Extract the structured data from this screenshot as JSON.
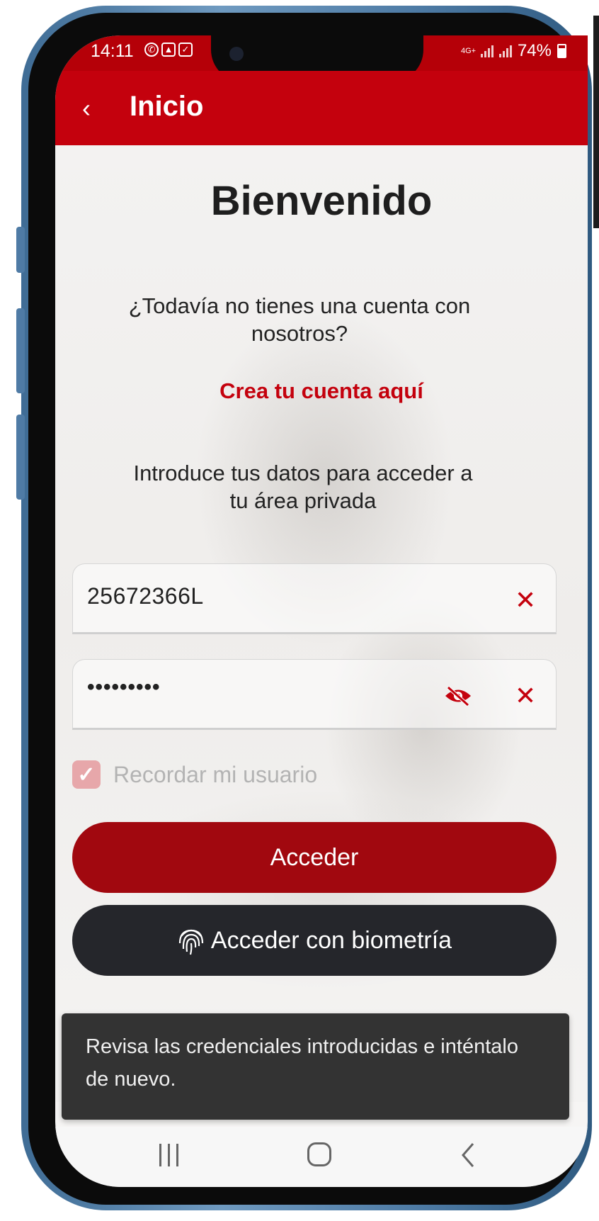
{
  "status_bar": {
    "time": "14:11",
    "icons": [
      "whatsapp-icon",
      "gallery-icon",
      "checkbox-icon"
    ],
    "network": "4G+",
    "battery": "74%",
    "battery_level": 0.74
  },
  "app_bar": {
    "title": "Inicio",
    "back_icon": "chevron-left-icon"
  },
  "welcome": "Bienvenido",
  "no_account_text": "¿Todavía no tienes una cuenta con nosotros?",
  "create_account_link": "Crea tu cuenta aquí",
  "intro_text": "Introduce tus datos para acceder a tu área privada",
  "form": {
    "username_value": "25672366L",
    "password_value": "•••••••••",
    "remember_label": "Recordar mi usuario",
    "remember_checked": true,
    "login_button": "Acceder",
    "biometric_button": "Acceder con biometría"
  },
  "toast": {
    "message": "Revisa las credenciales introducidas e inténtalo de nuevo."
  },
  "nav": {
    "recents": "recents-icon",
    "home": "home-icon",
    "back": "back-icon"
  },
  "colors": {
    "primary_red": "#c4010d",
    "button_red": "#a1080f",
    "button_dark": "#25262b",
    "toast_bg": "#333333"
  }
}
